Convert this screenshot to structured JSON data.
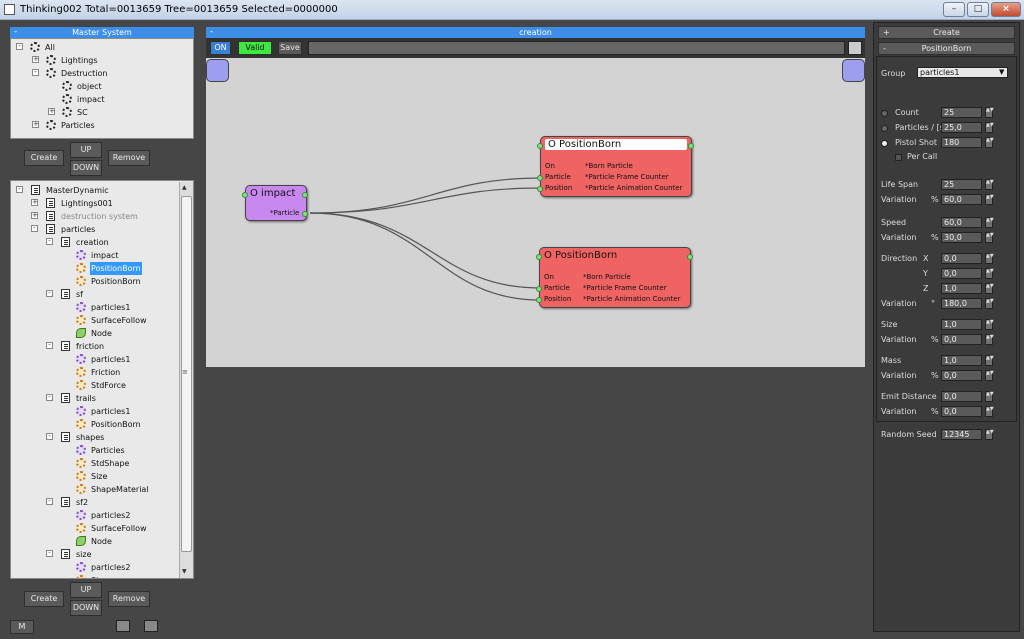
{
  "window": {
    "title": "Thinking002  Total=0013659  Tree=0013659  Selected=0000000",
    "min": "–",
    "max": "□",
    "close": "×"
  },
  "master_system": {
    "header": "Master System",
    "items": [
      "All",
      "Lightings",
      "Destruction",
      "object",
      "impact",
      "SC",
      "Particles"
    ]
  },
  "buttons": {
    "create": "Create",
    "up": "UP",
    "down": "DOWN",
    "remove": "Remove",
    "m": "M"
  },
  "master_dynamic": {
    "items": [
      "MasterDynamic",
      "Lightings001",
      "destruction system",
      "particles",
      "creation",
      "impact",
      "PositionBorn",
      "PositionBorn",
      "sf",
      "particles1",
      "SurfaceFollow",
      "Node",
      "friction",
      "particles1",
      "Friction",
      "StdForce",
      "trails",
      "particles1",
      "PositionBorn",
      "shapes",
      "Particles",
      "StdShape",
      "Size",
      "ShapeMaterial",
      "sf2",
      "particles2",
      "SurfaceFollow",
      "Node",
      "size",
      "particles2",
      "Size"
    ]
  },
  "graph": {
    "header": "creation",
    "on_label": "ON",
    "valid_label": "Valid",
    "save_label": "Save",
    "nodes": {
      "impact": {
        "title": "O impact",
        "out": "*Particle"
      },
      "pb1": {
        "title": "O PositionBorn",
        "rows": [
          [
            "On",
            "*Born Particle"
          ],
          [
            "Particle",
            "*Particle Frame Counter"
          ],
          [
            "Position",
            "*Particle Animation Counter"
          ]
        ]
      },
      "pb2": {
        "title": "O PositionBorn",
        "rows": [
          [
            "On",
            "*Born Particle"
          ],
          [
            "Particle",
            "*Particle Frame Counter"
          ],
          [
            "Position",
            "*Particle Animation Counter"
          ]
        ]
      }
    }
  },
  "right_panel": {
    "create_header": "Create",
    "section_header": "PositionBorn",
    "group_label": "Group",
    "group_value": "particles1",
    "count_label": "Count",
    "count_value": "25",
    "particles_label": "Particles  /  [s]",
    "particles_value": "25,0",
    "pistol_label": "Pistol Shot",
    "pistol_value": "180",
    "percall_label": "Per Call",
    "lifespan_label": "Life Span",
    "lifespan_value": "25",
    "variation_label": "Variation",
    "pct": "%",
    "deg": "°",
    "lifespan_var": "60,0",
    "speed_label": "Speed",
    "speed_value": "60,0",
    "speed_var": "30,0",
    "direction_label": "Direction",
    "x_label": "X",
    "y_label": "Y",
    "z_label": "Z",
    "dir_x": "0,0",
    "dir_y": "0,0",
    "dir_z": "1,0",
    "dir_var": "180,0",
    "size_label": "Size",
    "size_value": "1,0",
    "size_var": "0,0",
    "mass_label": "Mass",
    "mass_value": "1,0",
    "mass_var": "0,0",
    "emit_label": "Emit Distance",
    "emit_value": "0,0",
    "emit_var": "0,0",
    "seed_label": "Random Seed",
    "seed_value": "12345"
  }
}
